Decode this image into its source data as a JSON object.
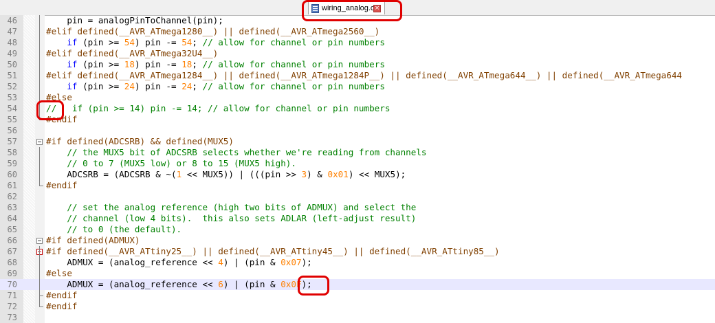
{
  "tab": {
    "label": "wiring_analog.c",
    "close_glyph": "×"
  },
  "colors": {
    "preprocessor": "#804000",
    "comment": "#008000",
    "number": "#ff8000",
    "keyword": "#0000ff",
    "operator": "#000080",
    "highlight_box": "#e00000",
    "active_line": "#e8e8ff"
  },
  "active_line": 70,
  "lines": [
    {
      "n": "46",
      "segs": [
        {
          "t": "    pin = analogPinToChannel(pin);",
          "c": ""
        }
      ]
    },
    {
      "n": "47",
      "segs": [
        {
          "t": "#elif defined(__AVR_ATmega1280__) || defined(__AVR_ATmega2560__)",
          "c": "pp"
        }
      ]
    },
    {
      "n": "48",
      "segs": [
        {
          "t": "    ",
          "c": ""
        },
        {
          "t": "if",
          "c": "kw"
        },
        {
          "t": " (pin >= ",
          "c": ""
        },
        {
          "t": "54",
          "c": "num"
        },
        {
          "t": ") pin -= ",
          "c": ""
        },
        {
          "t": "54",
          "c": "num"
        },
        {
          "t": "; ",
          "c": ""
        },
        {
          "t": "// allow for channel or pin numbers",
          "c": "cm"
        }
      ]
    },
    {
      "n": "49",
      "segs": [
        {
          "t": "#elif defined(__AVR_ATmega32U4__)",
          "c": "pp"
        }
      ]
    },
    {
      "n": "50",
      "segs": [
        {
          "t": "    ",
          "c": ""
        },
        {
          "t": "if",
          "c": "kw"
        },
        {
          "t": " (pin >= ",
          "c": ""
        },
        {
          "t": "18",
          "c": "num"
        },
        {
          "t": ") pin -= ",
          "c": ""
        },
        {
          "t": "18",
          "c": "num"
        },
        {
          "t": "; ",
          "c": ""
        },
        {
          "t": "// allow for channel or pin numbers",
          "c": "cm"
        }
      ]
    },
    {
      "n": "51",
      "segs": [
        {
          "t": "#elif defined(__AVR_ATmega1284__) || defined(__AVR_ATmega1284P__) || defined(__AVR_ATmega644__) || defined(__AVR_ATmega644",
          "c": "pp"
        }
      ]
    },
    {
      "n": "52",
      "segs": [
        {
          "t": "    ",
          "c": ""
        },
        {
          "t": "if",
          "c": "kw"
        },
        {
          "t": " (pin >= ",
          "c": ""
        },
        {
          "t": "24",
          "c": "num"
        },
        {
          "t": ") pin -= ",
          "c": ""
        },
        {
          "t": "24",
          "c": "num"
        },
        {
          "t": "; ",
          "c": ""
        },
        {
          "t": "// allow for channel or pin numbers",
          "c": "cm"
        }
      ]
    },
    {
      "n": "53",
      "segs": [
        {
          "t": "#else",
          "c": "pp"
        }
      ]
    },
    {
      "n": "54",
      "segs": [
        {
          "t": "//   if (pin >= 14) pin -= 14; // allow for channel or pin numbers",
          "c": "cm"
        }
      ]
    },
    {
      "n": "55",
      "segs": [
        {
          "t": "#endif",
          "c": "pp"
        }
      ]
    },
    {
      "n": "56",
      "segs": [
        {
          "t": "",
          "c": ""
        }
      ]
    },
    {
      "n": "57",
      "segs": [
        {
          "t": "#if defined(ADCSRB) && defined(MUX5)",
          "c": "pp"
        }
      ]
    },
    {
      "n": "58",
      "segs": [
        {
          "t": "    // the MUX5 bit of ADCSRB selects whether we're reading from channels",
          "c": "cm"
        }
      ]
    },
    {
      "n": "59",
      "segs": [
        {
          "t": "    // 0 to 7 (MUX5 low) or 8 to 15 (MUX5 high).",
          "c": "cm"
        }
      ]
    },
    {
      "n": "60",
      "segs": [
        {
          "t": "    ADCSRB = (ADCSRB & ~(",
          "c": ""
        },
        {
          "t": "1",
          "c": "num"
        },
        {
          "t": " << MUX5)) | (((pin >> ",
          "c": ""
        },
        {
          "t": "3",
          "c": "num"
        },
        {
          "t": ") & ",
          "c": ""
        },
        {
          "t": "0x01",
          "c": "num"
        },
        {
          "t": ") << MUX5);",
          "c": ""
        }
      ]
    },
    {
      "n": "61",
      "segs": [
        {
          "t": "#endif",
          "c": "pp"
        }
      ]
    },
    {
      "n": "62",
      "segs": [
        {
          "t": "",
          "c": ""
        }
      ]
    },
    {
      "n": "63",
      "segs": [
        {
          "t": "    // set the analog reference (high two bits of ADMUX) and select the",
          "c": "cm"
        }
      ]
    },
    {
      "n": "64",
      "segs": [
        {
          "t": "    // channel (low 4 bits).  this also sets ADLAR (left-adjust result)",
          "c": "cm"
        }
      ]
    },
    {
      "n": "65",
      "segs": [
        {
          "t": "    // to 0 (the default).",
          "c": "cm"
        }
      ]
    },
    {
      "n": "66",
      "segs": [
        {
          "t": "#if defined(ADMUX)",
          "c": "pp"
        }
      ]
    },
    {
      "n": "67",
      "segs": [
        {
          "t": "#if defined(__AVR_ATtiny25__) || defined(__AVR_ATtiny45__) || defined(__AVR_ATtiny85__)",
          "c": "pp"
        }
      ]
    },
    {
      "n": "68",
      "segs": [
        {
          "t": "    ADMUX = (analog_reference << ",
          "c": ""
        },
        {
          "t": "4",
          "c": "num"
        },
        {
          "t": ") | (pin & ",
          "c": ""
        },
        {
          "t": "0x07",
          "c": "num"
        },
        {
          "t": ");",
          "c": ""
        }
      ]
    },
    {
      "n": "69",
      "segs": [
        {
          "t": "#else",
          "c": "pp"
        }
      ]
    },
    {
      "n": "70",
      "segs": [
        {
          "t": "    ADMUX = (analog_reference << ",
          "c": ""
        },
        {
          "t": "6",
          "c": "num"
        },
        {
          "t": ") | (pin & ",
          "c": ""
        },
        {
          "t": "0x0F",
          "c": "num"
        },
        {
          "t": ");",
          "c": ""
        }
      ]
    },
    {
      "n": "71",
      "segs": [
        {
          "t": "#endif",
          "c": "pp"
        }
      ]
    },
    {
      "n": "72",
      "segs": [
        {
          "t": "#endif",
          "c": "pp"
        }
      ]
    },
    {
      "n": "73",
      "segs": [
        {
          "t": "",
          "c": ""
        }
      ]
    }
  ]
}
